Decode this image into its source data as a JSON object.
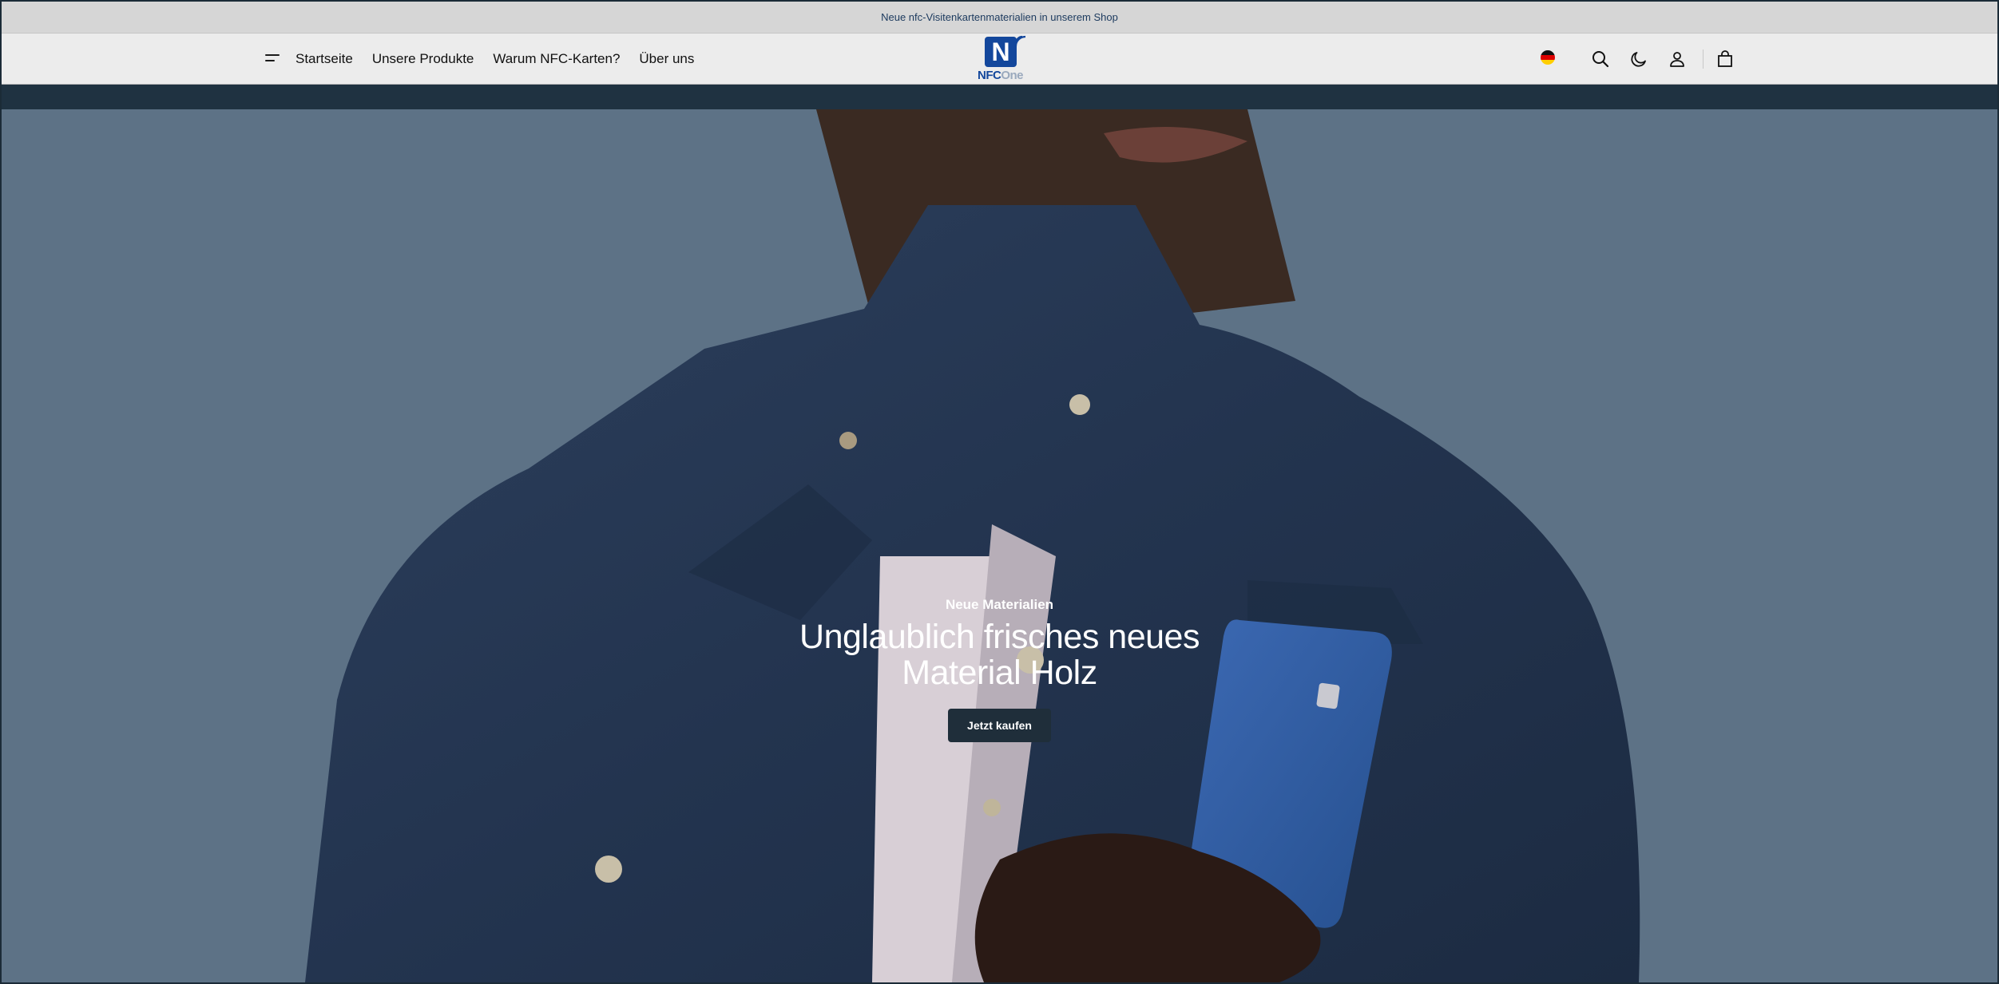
{
  "announcement": {
    "text": "Neue nfc-Visitenkartenmaterialien in unserem Shop"
  },
  "header": {
    "menu_icon": "hamburger-menu-icon",
    "nav": [
      {
        "label": "Startseite"
      },
      {
        "label": "Unsere Produkte"
      },
      {
        "label": "Warum NFC-Karten?"
      },
      {
        "label": "Über uns"
      }
    ],
    "logo": {
      "letter": "N",
      "part1": "NFC",
      "part2": "One"
    },
    "actions": {
      "language_icon": "german-flag-icon",
      "search_icon": "search-icon",
      "theme_icon": "moon-icon",
      "account_icon": "user-icon",
      "cart_icon": "shopping-bag-icon"
    }
  },
  "hero": {
    "eyebrow": "Neue Materialien",
    "headline_line1": "Unglaublich frisches neues",
    "headline_line2": "Material Holz",
    "cta": "Jetzt kaufen"
  },
  "colors": {
    "brand_blue": "#13479c",
    "dark": "#1f2e3a",
    "hero_background": "#5d7286"
  }
}
